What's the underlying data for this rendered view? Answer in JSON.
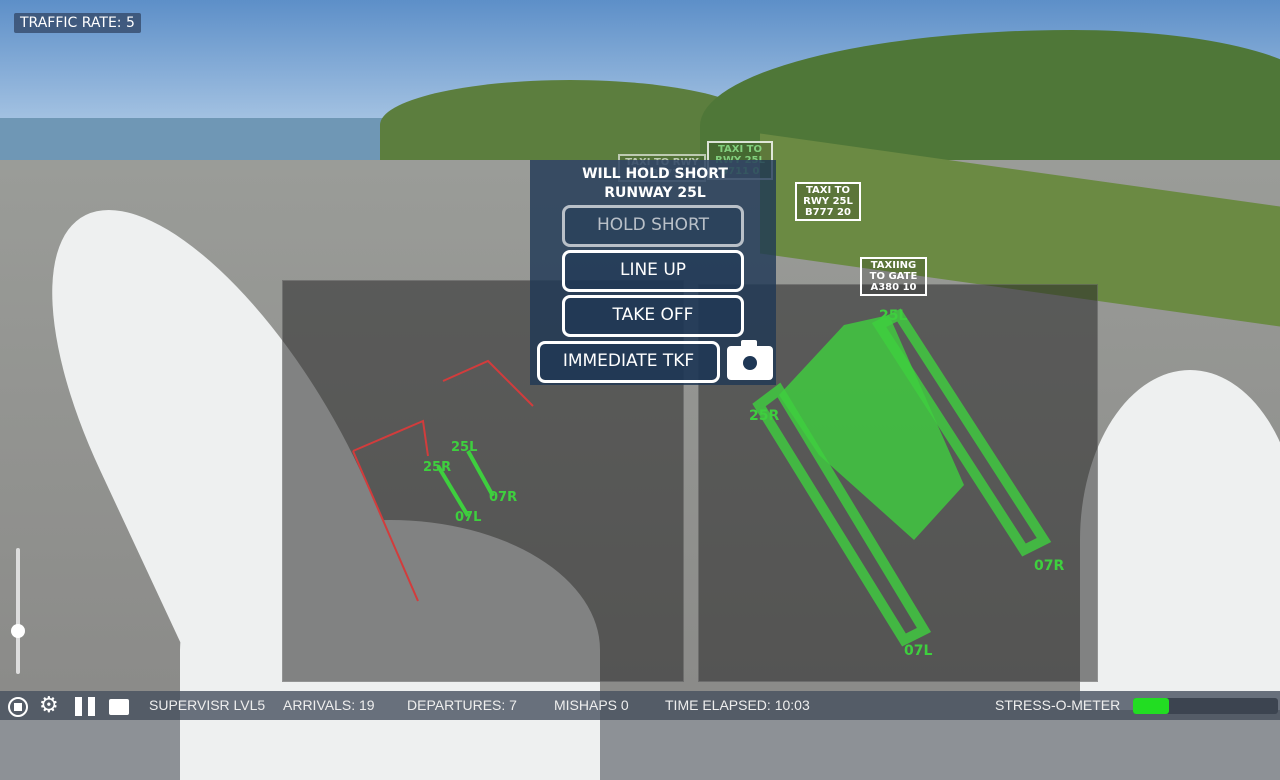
{
  "hud": {
    "traffic_rate": "TRAFFIC RATE: 5"
  },
  "tags": [
    {
      "text": "TAXI TO RWY 25L B777 20",
      "green": false
    },
    {
      "text": "TAXIING TO GATE A380 10",
      "green": false
    },
    {
      "text": "TAXI TO RWY 25L B777 20",
      "green": false
    },
    {
      "text": "TAXI TO RWY 25L B711 0",
      "green": true
    }
  ],
  "menu": {
    "title_line1": "WILL HOLD SHORT",
    "title_line2": "RUNWAY 25L",
    "hold_short": "HOLD SHORT",
    "line_up": "LINE UP",
    "take_off": "TAKE OFF",
    "immediate_tkf": "IMMEDIATE TKF",
    "camera_icon": "camera-icon"
  },
  "radar": {
    "left_labels": [
      "25R",
      "25L",
      "07L",
      "07R"
    ],
    "right_labels": [
      "25R",
      "25L",
      "07L",
      "07R"
    ],
    "active_color": "#3ecf3e",
    "route_color": "#d23c3c"
  },
  "status_bar": {
    "rank": "SUPERVISR LVL5",
    "arrivals": "ARRIVALS:  19",
    "departures": "DEPARTURES:  7",
    "mishaps": "MISHAPS  0",
    "time": "TIME ELAPSED:  10:03",
    "stress_label": "STRESS-O-METER",
    "stress_level": 0.25,
    "stress_color": "#22dd22"
  },
  "icons": [
    "stop-icon",
    "gear-icon",
    "pause-icon",
    "camera-icon"
  ]
}
